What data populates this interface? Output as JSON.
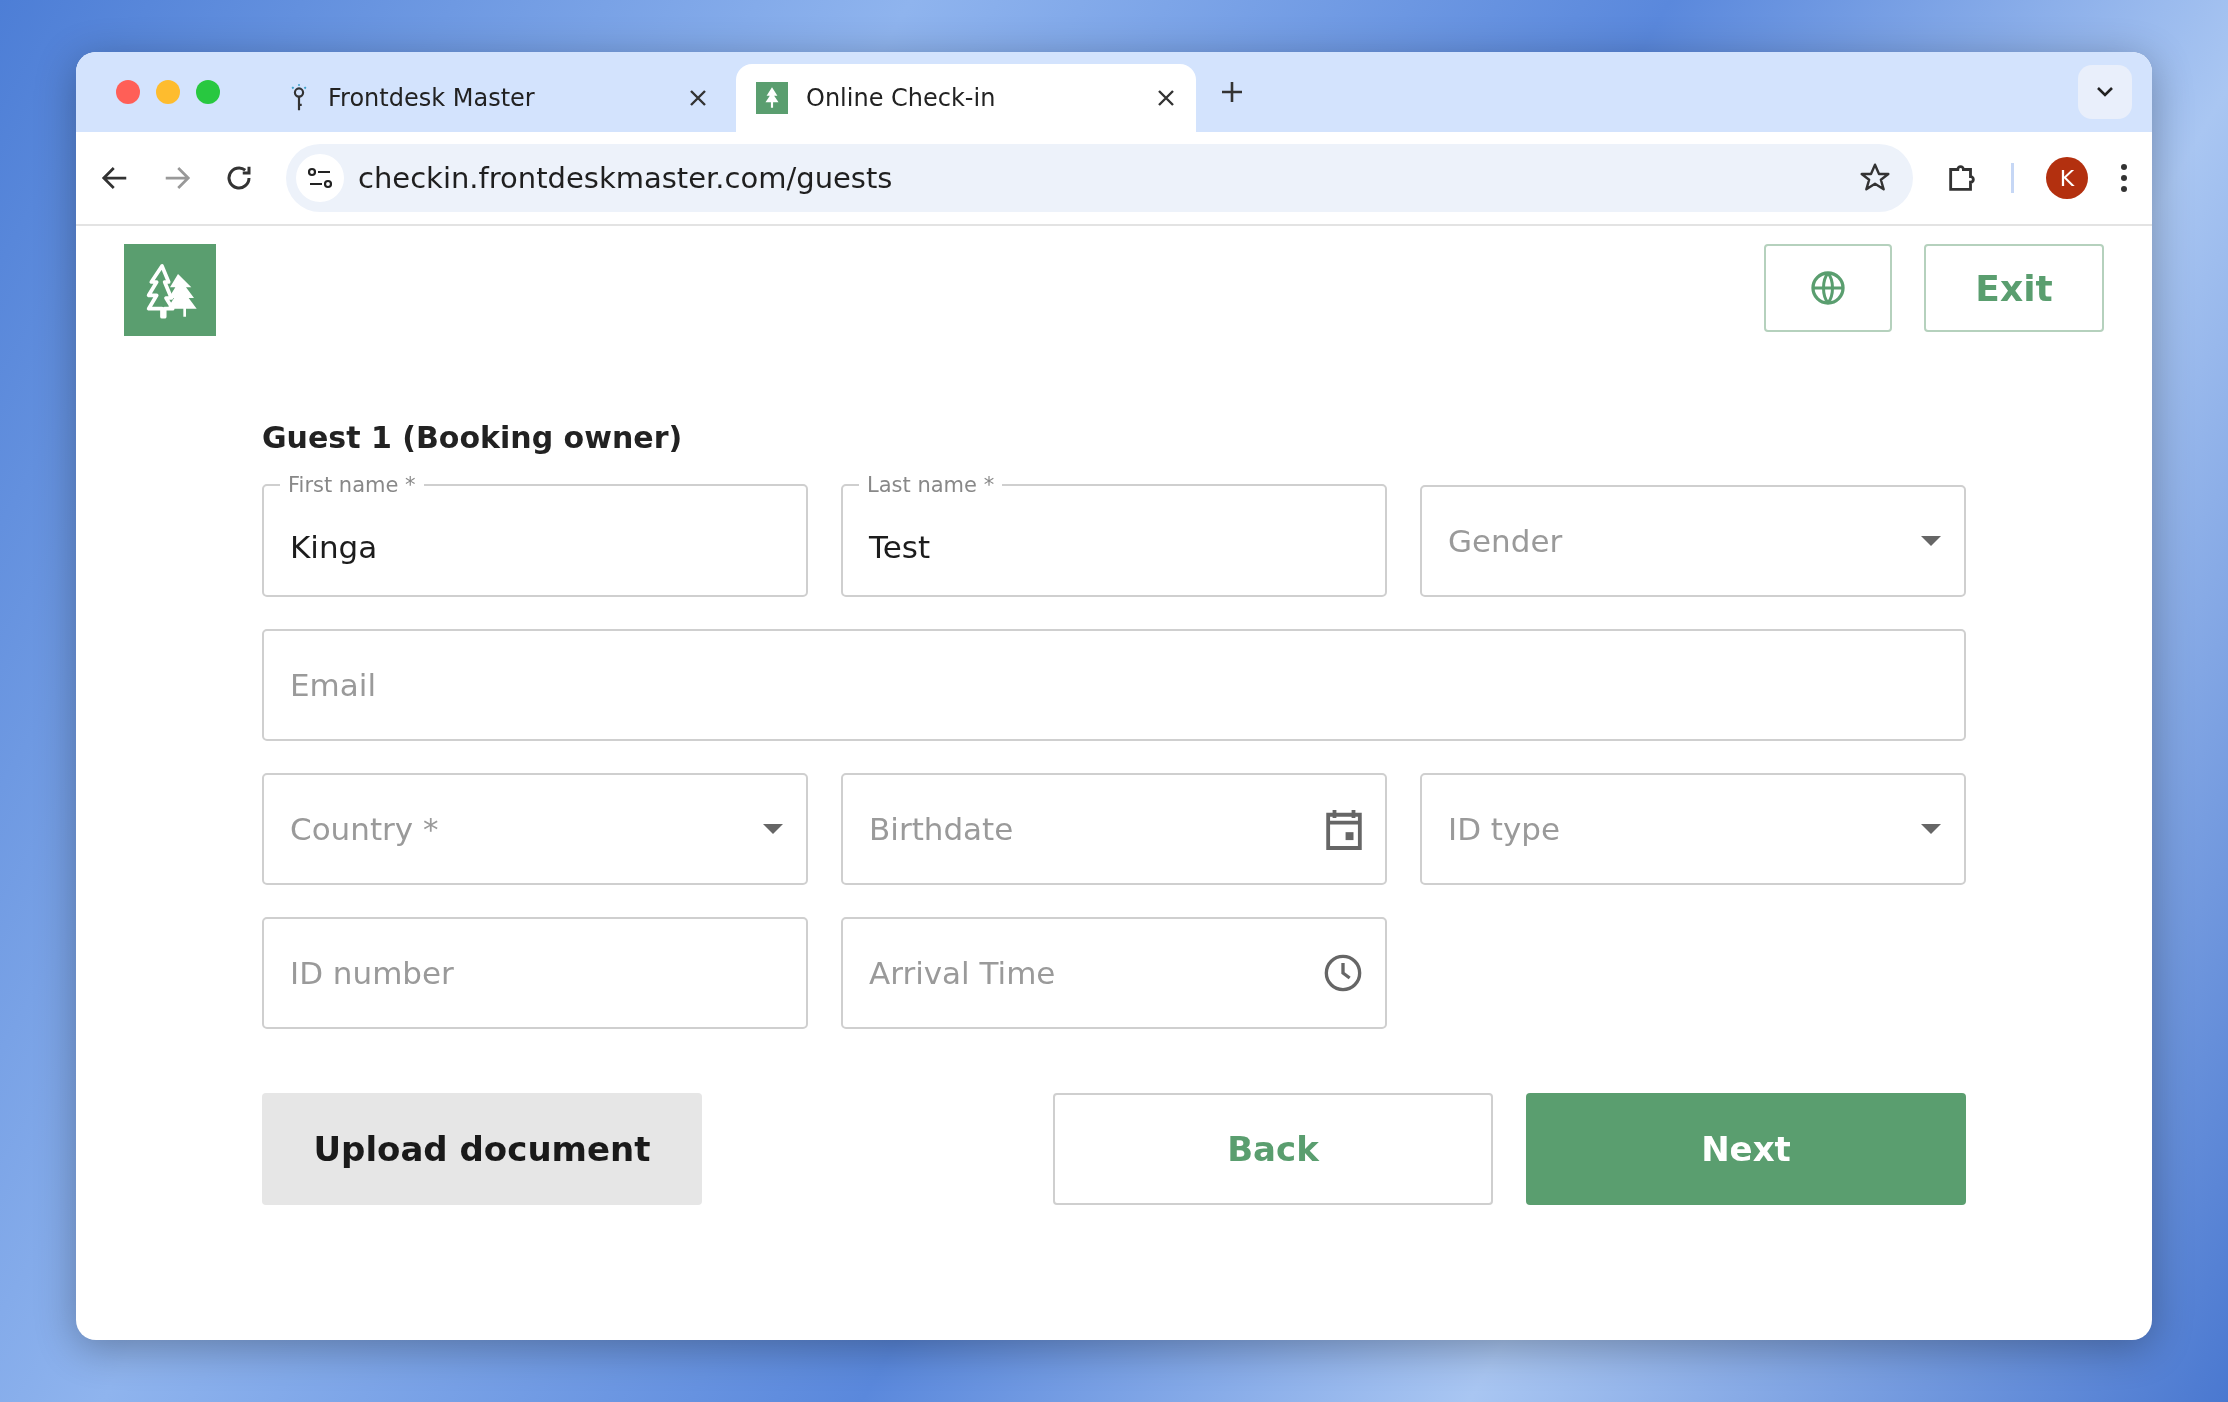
{
  "browser": {
    "tabs": [
      {
        "title": "Frontdesk Master",
        "selected": false
      },
      {
        "title": "Online Check-in",
        "selected": true
      }
    ],
    "url": "checkin.frontdeskmaster.com/guests",
    "profile": "K"
  },
  "header": {
    "exit": "Exit"
  },
  "form": {
    "title": "Guest 1 (Booking owner)",
    "fields": [
      {
        "kind": "text",
        "label": "First name *",
        "value": "Kinga"
      },
      {
        "kind": "text",
        "label": "Last name *",
        "value": "Test"
      },
      {
        "kind": "select",
        "placeholder": "Gender"
      },
      {
        "kind": "email",
        "placeholder": "Email"
      },
      {
        "kind": "select",
        "placeholder": "Country *"
      },
      {
        "kind": "date",
        "placeholder": "Birthdate"
      },
      {
        "kind": "select",
        "placeholder": "ID type"
      },
      {
        "kind": "text",
        "placeholder": "ID number"
      },
      {
        "kind": "time",
        "placeholder": "Arrival Time"
      }
    ],
    "upload": "Upload document",
    "back": "Back",
    "next": "Next"
  }
}
